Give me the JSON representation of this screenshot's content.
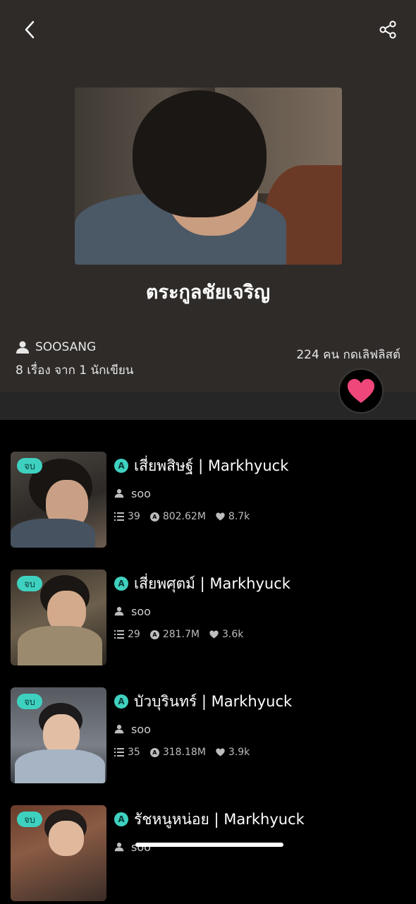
{
  "icons": {
    "back": "chevron-left-icon",
    "share": "share-icon",
    "heart": "heart-icon",
    "user": "user-icon"
  },
  "colors": {
    "accent": "#3fd1c0",
    "heart": "#f0477a",
    "header_bg": "#2f2b29"
  },
  "collection": {
    "title": "ตระกูลชัยเจริญ",
    "author": "SOOSANG",
    "counts": "8 เรื่อง จาก 1 นักเขียน",
    "likes": "224 คน กดเลิฟลิสต์"
  },
  "stories": [
    {
      "badge": "จบ",
      "title": "เสี่ยพสิษฐ์ | Markhyuck",
      "author": "soo",
      "chapters": "39",
      "views": "802.62M",
      "hearts": "8.7k"
    },
    {
      "badge": "จบ",
      "title": "เสี่ยพศุตม์ | Markhyuck",
      "author": "soo",
      "chapters": "29",
      "views": "281.7M",
      "hearts": "3.6k"
    },
    {
      "badge": "จบ",
      "title": "บัวบุรินทร์ | Markhyuck",
      "author": "soo",
      "chapters": "35",
      "views": "318.18M",
      "hearts": "3.9k"
    },
    {
      "badge": "จบ",
      "title": "รัชหนูหน่อย | Markhyuck",
      "author": "soo",
      "chapters": "",
      "views": "",
      "hearts": ""
    }
  ]
}
